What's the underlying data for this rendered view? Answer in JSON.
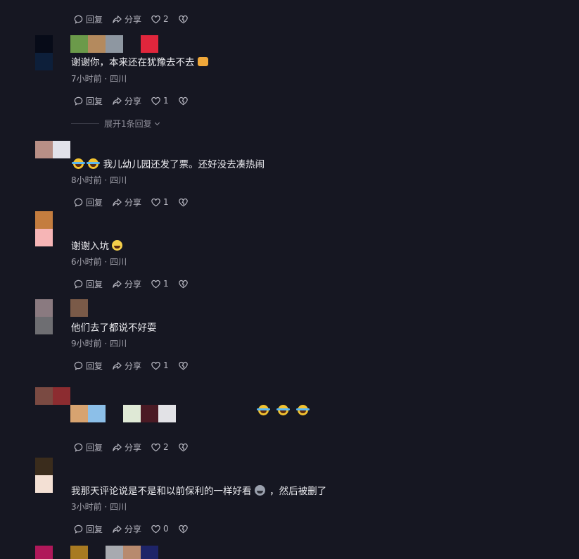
{
  "action_labels": {
    "reply": "回复",
    "share": "分享"
  },
  "expand_label": "展开1条回复",
  "comments": [
    {
      "likes": "2"
    },
    {
      "text": "谢谢你，本来还在犹豫去不去",
      "meta": "7小时前 · 四川",
      "likes": "1"
    },
    {
      "text": "我儿幼儿园还发了票。还好没去凑热闹",
      "meta": "8小时前 · 四川",
      "likes": "1"
    },
    {
      "text": "谢谢入坑",
      "meta": "6小时前 · 四川",
      "likes": "1"
    },
    {
      "text": "他们去了都说不好耍",
      "meta": "9小时前 · 四川",
      "likes": "1"
    },
    {
      "likes": "2"
    },
    {
      "text_a": "我那天评论说是不是和以前保利的一样好看",
      "text_b": "，然后被删了",
      "meta": "3小时前 · 四川",
      "likes": "0"
    }
  ],
  "icons": {
    "reply": "speech-bubble-icon",
    "share": "share-arrow-icon",
    "like": "heart-icon",
    "dislike": "broken-heart-icon",
    "expand": "chevron-down-icon"
  },
  "emojis": {
    "laugh_cry": "rolling-laugh-emoji",
    "thumbs_up": "thumbs-up-emoji",
    "grin": "grimace-emoji",
    "cat": "cat-emoji"
  },
  "colors": {
    "background": "#161722",
    "text": "#ececf0",
    "meta": "#a3a3ad"
  }
}
